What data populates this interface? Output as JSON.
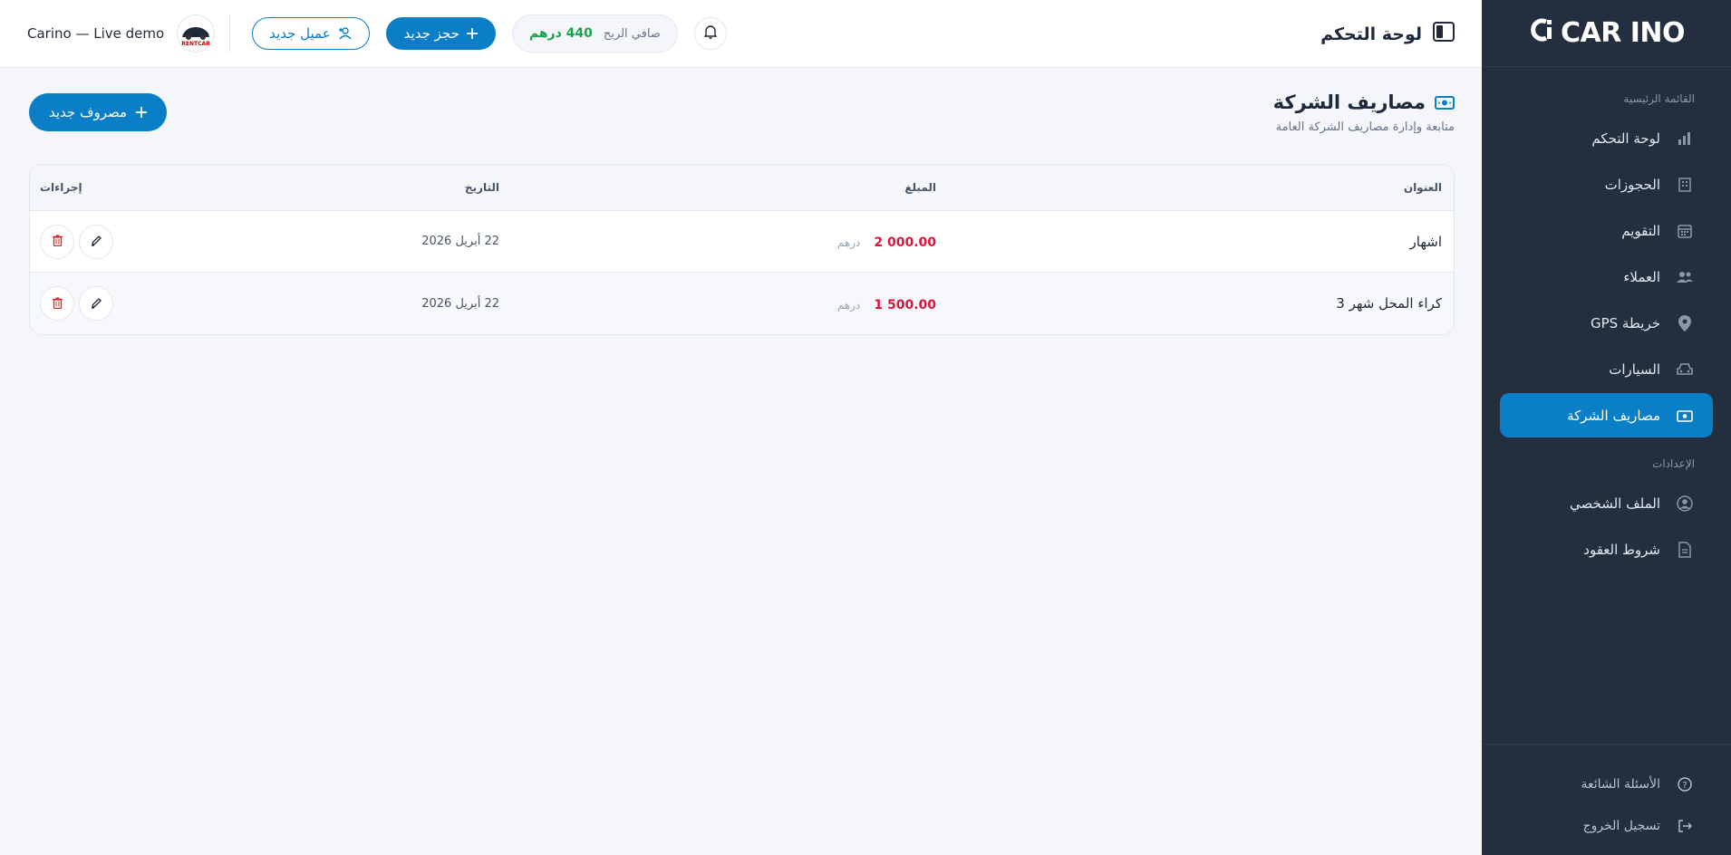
{
  "sidebar": {
    "brand": "CAR INO",
    "main_section": "القائمة الرئيسية",
    "settings_section": "الإعدادات",
    "items": [
      {
        "label": "لوحة التحكم",
        "icon": "bar-chart-icon"
      },
      {
        "label": "الحجوزات",
        "icon": "building-icon"
      },
      {
        "label": "التقويم",
        "icon": "calendar-icon"
      },
      {
        "label": "العملاء",
        "icon": "users-icon"
      },
      {
        "label": "خريطة GPS",
        "icon": "map-pin-icon"
      },
      {
        "label": "السيارات",
        "icon": "car-icon"
      },
      {
        "label": "مصاريف الشركة",
        "icon": "cash-icon",
        "active": true
      }
    ],
    "settings_items": [
      {
        "label": "الملف الشخصي",
        "icon": "user-circle-icon"
      },
      {
        "label": "شروط العقود",
        "icon": "document-icon"
      }
    ],
    "bottom_items": [
      {
        "label": "الأسئلة الشائعة",
        "icon": "help-circle-icon"
      },
      {
        "label": "تسجيل الخروج",
        "icon": "logout-icon"
      }
    ]
  },
  "topbar": {
    "title": "لوحة التحكم",
    "profit_label": "صافي الربح",
    "profit_value": "440 درهم",
    "new_booking": "حجز جديد",
    "new_client": "عميل جديد",
    "account_name": "Carino — Live demo",
    "account_logo_text": "RENTCAR"
  },
  "page": {
    "title": "مصاريف الشركة",
    "subtitle": "متابعة وإدارة مصاريف الشركة العامة",
    "add_button": "مصروف جديد"
  },
  "table": {
    "headers": {
      "title": "العنوان",
      "amount": "المبلغ",
      "date": "التاريخ",
      "actions": "إجراءات"
    },
    "rows": [
      {
        "title": "اشهار",
        "amount": "2 000.00",
        "currency": "درهم",
        "date": "22 أبريل 2026"
      },
      {
        "title": "كراء المحل شهر 3",
        "amount": "1 500.00",
        "currency": "درهم",
        "date": "22 أبريل 2026"
      }
    ]
  },
  "colors": {
    "primary": "#0a7ec7",
    "sidebar_bg": "#232e3e",
    "amount_red": "#dc143c",
    "profit_green": "#16a34a"
  }
}
